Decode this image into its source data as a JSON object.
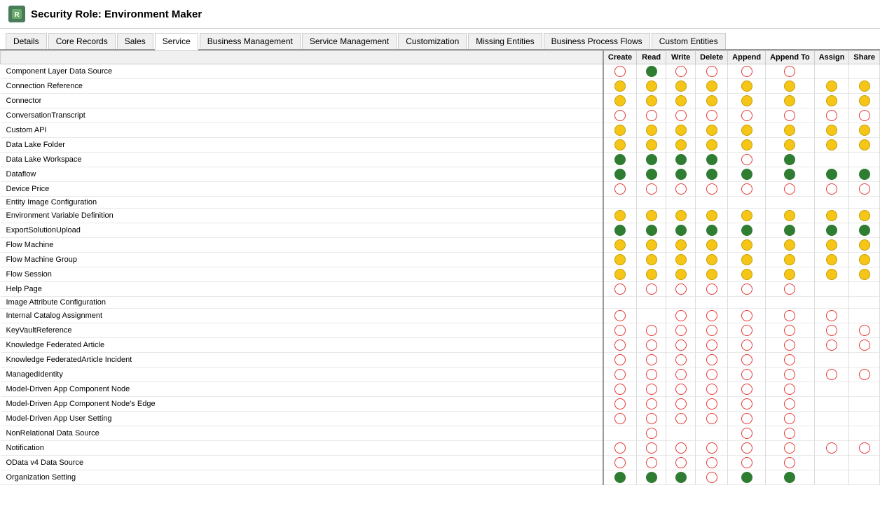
{
  "title": "Security Role: Environment Maker",
  "tabs": [
    {
      "label": "Details",
      "active": false
    },
    {
      "label": "Core Records",
      "active": false
    },
    {
      "label": "Sales",
      "active": false
    },
    {
      "label": "Service",
      "active": true
    },
    {
      "label": "Business Management",
      "active": false
    },
    {
      "label": "Service Management",
      "active": false
    },
    {
      "label": "Customization",
      "active": false
    },
    {
      "label": "Missing Entities",
      "active": false
    },
    {
      "label": "Business Process Flows",
      "active": false
    },
    {
      "label": "Custom Entities",
      "active": false
    }
  ],
  "columns": [
    "",
    "Create",
    "Read",
    "Write",
    "Delete",
    "Append",
    "Append To",
    "Assign",
    "Share"
  ],
  "rows": [
    {
      "name": "Component Layer Data Source",
      "perms": [
        "red-empty",
        "green-full",
        "red-empty",
        "red-empty",
        "red-empty",
        "red-empty",
        "none",
        "none"
      ]
    },
    {
      "name": "Connection Reference",
      "perms": [
        "yellow",
        "yellow",
        "yellow",
        "yellow",
        "yellow",
        "yellow",
        "yellow",
        "yellow"
      ]
    },
    {
      "name": "Connector",
      "perms": [
        "yellow",
        "yellow",
        "yellow",
        "yellow",
        "yellow",
        "yellow",
        "yellow",
        "yellow"
      ]
    },
    {
      "name": "ConversationTranscript",
      "perms": [
        "red-empty",
        "red-empty",
        "red-empty",
        "red-empty",
        "red-empty",
        "red-empty",
        "red-empty",
        "red-empty"
      ]
    },
    {
      "name": "Custom API",
      "perms": [
        "yellow",
        "yellow",
        "yellow",
        "yellow",
        "yellow",
        "yellow",
        "yellow",
        "yellow"
      ]
    },
    {
      "name": "Data Lake Folder",
      "perms": [
        "yellow",
        "yellow",
        "yellow",
        "yellow",
        "yellow",
        "yellow",
        "yellow",
        "yellow"
      ]
    },
    {
      "name": "Data Lake Workspace",
      "perms": [
        "green-full",
        "green-full",
        "green-full",
        "green-full",
        "red-empty",
        "green-full",
        "none",
        "none"
      ]
    },
    {
      "name": "Dataflow",
      "perms": [
        "green-full",
        "green-full",
        "green-full",
        "green-full",
        "green-full",
        "green-full",
        "green-full",
        "green-full"
      ]
    },
    {
      "name": "Device Price",
      "perms": [
        "red-empty",
        "red-empty",
        "red-empty",
        "red-empty",
        "red-empty",
        "red-empty",
        "red-empty",
        "red-empty"
      ]
    },
    {
      "name": "Entity Image Configuration",
      "perms": [
        "none",
        "none",
        "none",
        "none",
        "none",
        "none",
        "none",
        "none"
      ]
    },
    {
      "name": "Environment Variable Definition",
      "perms": [
        "yellow",
        "yellow",
        "yellow",
        "yellow",
        "yellow",
        "yellow",
        "yellow",
        "yellow"
      ]
    },
    {
      "name": "ExportSolutionUpload",
      "perms": [
        "green-full",
        "green-full",
        "green-full",
        "green-full",
        "green-full",
        "green-full",
        "green-full",
        "green-full"
      ]
    },
    {
      "name": "Flow Machine",
      "perms": [
        "yellow",
        "yellow",
        "yellow",
        "yellow",
        "yellow",
        "yellow",
        "yellow",
        "yellow"
      ]
    },
    {
      "name": "Flow Machine Group",
      "perms": [
        "yellow",
        "yellow",
        "yellow",
        "yellow",
        "yellow",
        "yellow",
        "yellow",
        "yellow"
      ]
    },
    {
      "name": "Flow Session",
      "perms": [
        "yellow",
        "yellow",
        "yellow",
        "yellow",
        "yellow",
        "yellow",
        "yellow",
        "yellow"
      ]
    },
    {
      "name": "Help Page",
      "perms": [
        "red-empty",
        "red-empty",
        "red-empty",
        "red-empty",
        "red-empty",
        "red-empty",
        "none",
        "none"
      ]
    },
    {
      "name": "Image Attribute Configuration",
      "perms": [
        "none",
        "none",
        "none",
        "none",
        "none",
        "none",
        "none",
        "none"
      ]
    },
    {
      "name": "Internal Catalog Assignment",
      "perms": [
        "red-empty",
        "none",
        "red-empty",
        "red-empty",
        "red-empty",
        "red-empty",
        "red-empty",
        "none"
      ]
    },
    {
      "name": "KeyVaultReference",
      "perms": [
        "red-empty",
        "red-empty",
        "red-empty",
        "red-empty",
        "red-empty",
        "red-empty",
        "red-empty",
        "red-empty"
      ]
    },
    {
      "name": "Knowledge Federated Article",
      "perms": [
        "red-empty",
        "red-empty",
        "red-empty",
        "red-empty",
        "red-empty",
        "red-empty",
        "red-empty",
        "red-empty"
      ]
    },
    {
      "name": "Knowledge FederatedArticle Incident",
      "perms": [
        "red-empty",
        "red-empty",
        "red-empty",
        "red-empty",
        "red-empty",
        "red-empty",
        "none",
        "none"
      ]
    },
    {
      "name": "ManagedIdentity",
      "perms": [
        "red-empty",
        "red-empty",
        "red-empty",
        "red-empty",
        "red-empty",
        "red-empty",
        "red-empty",
        "red-empty"
      ]
    },
    {
      "name": "Model-Driven App Component Node",
      "perms": [
        "red-empty",
        "red-empty",
        "red-empty",
        "red-empty",
        "red-empty",
        "red-empty",
        "none",
        "none"
      ]
    },
    {
      "name": "Model-Driven App Component Node's Edge",
      "perms": [
        "red-empty",
        "red-empty",
        "red-empty",
        "red-empty",
        "red-empty",
        "red-empty",
        "none",
        "none"
      ]
    },
    {
      "name": "Model-Driven App User Setting",
      "perms": [
        "red-empty",
        "red-empty",
        "red-empty",
        "red-empty",
        "red-empty",
        "red-empty",
        "none",
        "none"
      ]
    },
    {
      "name": "NonRelational Data Source",
      "perms": [
        "none",
        "red-empty",
        "none",
        "none",
        "red-empty",
        "red-empty",
        "none",
        "none"
      ]
    },
    {
      "name": "Notification",
      "perms": [
        "red-empty",
        "red-empty",
        "red-empty",
        "red-empty",
        "red-empty",
        "red-empty",
        "red-empty",
        "red-empty"
      ]
    },
    {
      "name": "OData v4 Data Source",
      "perms": [
        "red-empty",
        "red-empty",
        "red-empty",
        "red-empty",
        "red-empty",
        "red-empty",
        "none",
        "none"
      ]
    },
    {
      "name": "Organization Setting",
      "perms": [
        "green-full",
        "green-full",
        "green-full",
        "red-empty",
        "green-full",
        "green-full",
        "none",
        "none"
      ]
    }
  ]
}
